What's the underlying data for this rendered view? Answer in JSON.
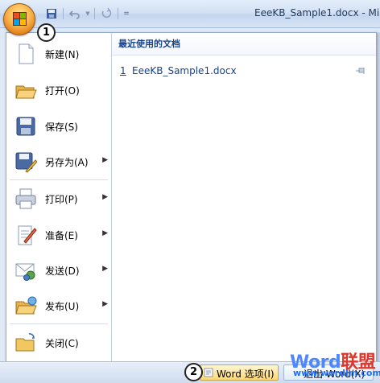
{
  "title_bar": {
    "document_title": "EeeKB_Sample1.docx - Mi",
    "qat": {
      "save_icon": "save-icon",
      "undo_icon": "undo-icon",
      "redo_icon": "redo-icon",
      "customize_icon": "dropdown-icon"
    }
  },
  "markers": {
    "one": "1",
    "two": "2"
  },
  "menu": {
    "commands": [
      {
        "label": "新建(N)",
        "icon": "new-document-icon",
        "submenu": false
      },
      {
        "label": "打开(O)",
        "icon": "open-folder-icon",
        "submenu": false
      },
      {
        "label": "保存(S)",
        "icon": "save-disk-icon",
        "submenu": false
      },
      {
        "label": "另存为(A)",
        "icon": "save-as-icon",
        "submenu": true
      },
      {
        "label": "打印(P)",
        "icon": "printer-icon",
        "submenu": true
      },
      {
        "label": "准备(E)",
        "icon": "prepare-icon",
        "submenu": true
      },
      {
        "label": "发送(D)",
        "icon": "send-icon",
        "submenu": true
      },
      {
        "label": "发布(U)",
        "icon": "publish-icon",
        "submenu": true
      },
      {
        "label": "关闭(C)",
        "icon": "close-folder-icon",
        "submenu": false
      }
    ],
    "recent": {
      "heading": "最近使用的文档",
      "items": [
        {
          "number": "1",
          "name": "EeeKB_Sample1.docx"
        }
      ]
    }
  },
  "bottom": {
    "options_label": "Word 选项(I)",
    "exit_label": "退出 Word(X)"
  },
  "watermark": {
    "main": "Word",
    "accent": "联盟",
    "url": "www.wordlm.com"
  },
  "colors": {
    "accent": "#15428b",
    "panel_border": "#8ea7cb",
    "options_button": "#ffd871"
  }
}
